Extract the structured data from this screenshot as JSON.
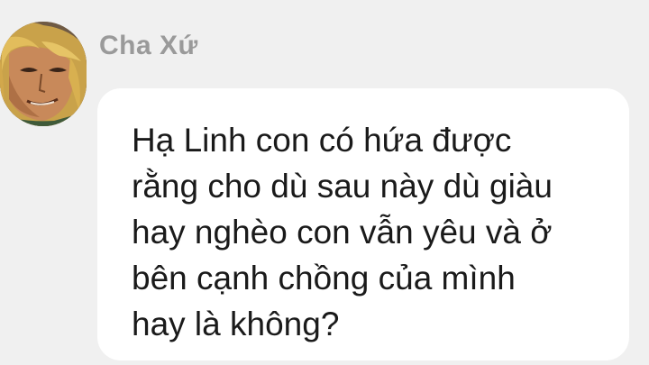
{
  "chat": {
    "sender_name": "Cha Xứ",
    "avatar_icon": "character-portrait-avatar",
    "message": "Hạ Linh con có hứa được\nrằng cho dù sau này dù giàu\nhay nghèo con vẫn yêu và ở\nbên cạnh chồng của mình\nhay là không?"
  },
  "colors": {
    "background": "#f0f0f0",
    "bubble": "#ffffff",
    "sender_name": "#9a9a9a",
    "message_text": "#1a1a1a"
  }
}
